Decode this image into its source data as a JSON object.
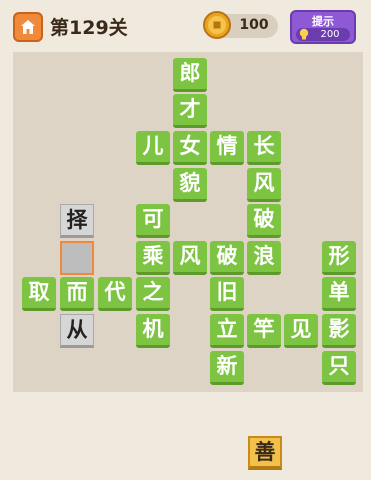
{
  "header": {
    "home_icon": "home-icon",
    "level_title": "第129关",
    "coins": "100",
    "coin_icon": "coin-icon",
    "hint_label": "提示",
    "hint_cost": "200",
    "hint_icon": "lightbulb-icon"
  },
  "board": {
    "tiles": [
      {
        "id": "r0c4",
        "char": "郎",
        "style": "green"
      },
      {
        "id": "r1c4",
        "char": "才",
        "style": "green"
      },
      {
        "id": "r2c3",
        "char": "儿",
        "style": "green"
      },
      {
        "id": "r2c4",
        "char": "女",
        "style": "green"
      },
      {
        "id": "r2c5",
        "char": "情",
        "style": "green"
      },
      {
        "id": "r2c6",
        "char": "长",
        "style": "green"
      },
      {
        "id": "r3c4",
        "char": "貌",
        "style": "green"
      },
      {
        "id": "r3c6",
        "char": "风",
        "style": "green"
      },
      {
        "id": "r4c1",
        "char": "择",
        "style": "gray"
      },
      {
        "id": "r4c3",
        "char": "可",
        "style": "green"
      },
      {
        "id": "r4c6",
        "char": "破",
        "style": "green"
      },
      {
        "id": "r5c1",
        "char": "",
        "style": "empty"
      },
      {
        "id": "r5c3",
        "char": "乘",
        "style": "green"
      },
      {
        "id": "r5c4",
        "char": "风",
        "style": "green"
      },
      {
        "id": "r5c5",
        "char": "破",
        "style": "green"
      },
      {
        "id": "r5c6",
        "char": "浪",
        "style": "green"
      },
      {
        "id": "r5c8",
        "char": "形",
        "style": "green"
      },
      {
        "id": "r6c0",
        "char": "取",
        "style": "green"
      },
      {
        "id": "r6c1",
        "char": "而",
        "style": "green"
      },
      {
        "id": "r6c2",
        "char": "代",
        "style": "green"
      },
      {
        "id": "r6c3",
        "char": "之",
        "style": "green"
      },
      {
        "id": "r6c5",
        "char": "旧",
        "style": "green"
      },
      {
        "id": "r6c8",
        "char": "单",
        "style": "green"
      },
      {
        "id": "r7c1",
        "char": "从",
        "style": "gray"
      },
      {
        "id": "r7c3",
        "char": "机",
        "style": "green"
      },
      {
        "id": "r7c5",
        "char": "立",
        "style": "green"
      },
      {
        "id": "r7c6",
        "char": "竿",
        "style": "green"
      },
      {
        "id": "r7c7",
        "char": "见",
        "style": "green"
      },
      {
        "id": "r7c8",
        "char": "影",
        "style": "green"
      },
      {
        "id": "r8c5",
        "char": "新",
        "style": "green"
      },
      {
        "id": "r8c8",
        "char": "只",
        "style": "green"
      }
    ]
  },
  "candidates": [
    {
      "char": "善"
    }
  ]
}
